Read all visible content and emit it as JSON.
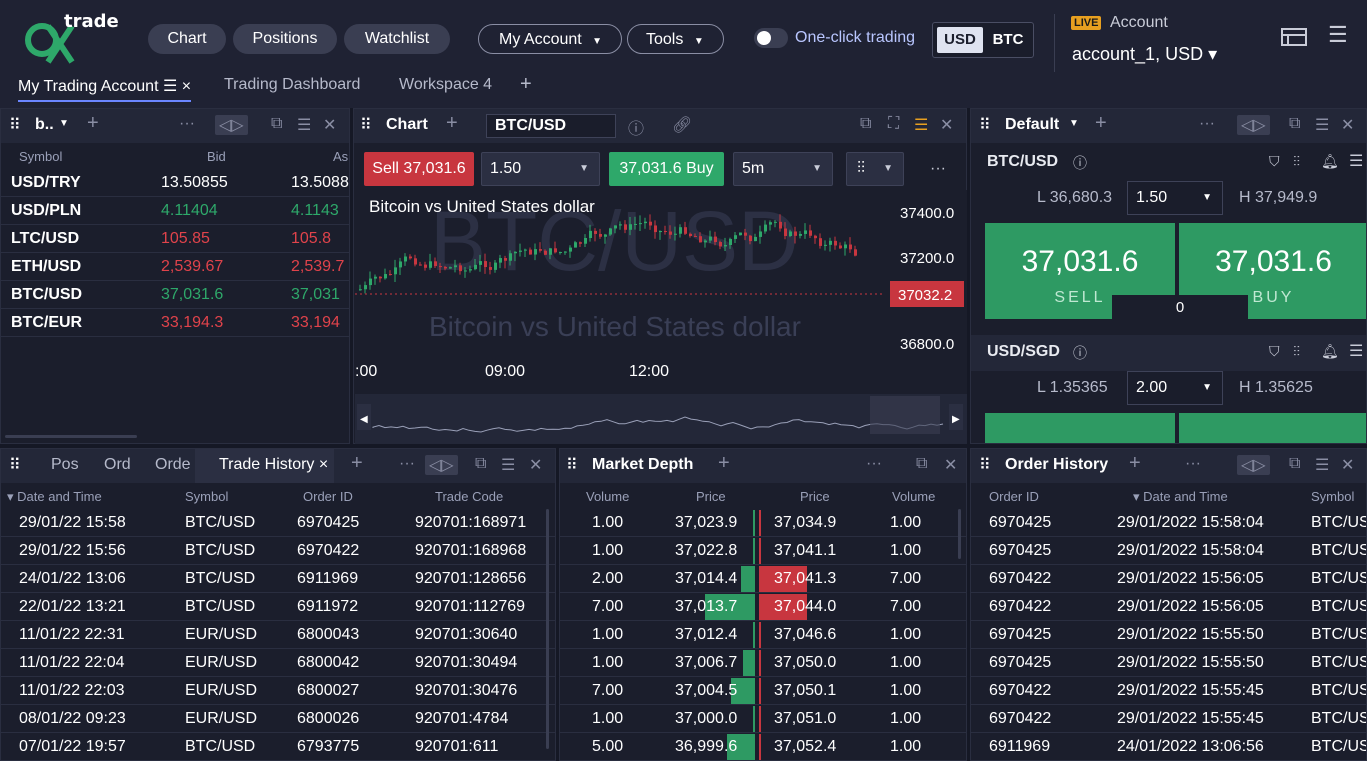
{
  "app": {
    "logo_text": "trade"
  },
  "nav": {
    "chart": "Chart",
    "positions": "Positions",
    "watchlist": "Watchlist",
    "my_account": "My Account",
    "tools": "Tools"
  },
  "one_click": "One-click trading",
  "currency": {
    "usd": "USD",
    "btc": "BTC"
  },
  "account": {
    "live": "LIVE",
    "label": "Account",
    "value": "account_1, USD ▾"
  },
  "workspace_tabs": [
    "My Trading Account ☰ ×",
    "Trading Dashboard",
    "Workspace 4",
    "+"
  ],
  "watchlist": {
    "title": "b..",
    "columns": [
      "Symbol",
      "Bid",
      "As"
    ],
    "rows": [
      {
        "symbol": "USD/TRY",
        "bid": "13.50855",
        "ask": "13.5088",
        "color": "#ffffff"
      },
      {
        "symbol": "USD/PLN",
        "bid": "4.11404",
        "ask": "4.1143",
        "color": "#2ea86a"
      },
      {
        "symbol": "LTC/USD",
        "bid": "105.85",
        "ask": "105.8",
        "color": "#e0434b"
      },
      {
        "symbol": "ETH/USD",
        "bid": "2,539.67",
        "ask": "2,539.7",
        "color": "#e0434b"
      },
      {
        "symbol": "BTC/USD",
        "bid": "37,031.6",
        "ask": "37,031",
        "color": "#2ea86a"
      },
      {
        "symbol": "BTC/EUR",
        "bid": "33,194.3",
        "ask": "33,194",
        "color": "#e0434b"
      }
    ]
  },
  "chart": {
    "title": "Chart",
    "symbol": "BTC/USD",
    "sell": "Sell 37,031.6",
    "qty": "1.50",
    "buy": "37,031.6 Buy",
    "interval": "5m",
    "name": "Bitcoin vs United States dollar",
    "watermark": "BTC/USD",
    "watermark2": "Bitcoin vs United States dollar",
    "price_labels": [
      "37400.0",
      "37200.0",
      "37032.2",
      "36800.0"
    ],
    "time_labels": [
      ":00",
      "09:00",
      "12:00"
    ]
  },
  "default_panel": {
    "title": "Default",
    "pairs": [
      {
        "symbol": "BTC/USD",
        "low": "L 36,680.3",
        "qty": "1.50",
        "high": "H 37,949.9",
        "sell": "37,031.6",
        "buy": "37,031.6",
        "sell_label": "SELL",
        "buy_label": "BUY",
        "spread": "0"
      },
      {
        "symbol": "USD/SGD",
        "low": "L 1.35365",
        "qty": "2.00",
        "high": "H 1.35625"
      }
    ]
  },
  "trade_history": {
    "tabs": [
      "Pos",
      "Ord",
      "Orde",
      "Trade History ×"
    ],
    "columns": [
      "▾ Date and Time",
      "Symbol",
      "Order ID",
      "Trade Code"
    ],
    "rows": [
      [
        "29/01/22 15:58",
        "BTC/USD",
        "6970425",
        "920701:168971"
      ],
      [
        "29/01/22 15:56",
        "BTC/USD",
        "6970422",
        "920701:168968"
      ],
      [
        "24/01/22 13:06",
        "BTC/USD",
        "6911969",
        "920701:128656"
      ],
      [
        "22/01/22 13:21",
        "BTC/USD",
        "6911972",
        "920701:112769"
      ],
      [
        "11/01/22 22:31",
        "EUR/USD",
        "6800043",
        "920701:30640"
      ],
      [
        "11/01/22 22:04",
        "EUR/USD",
        "6800042",
        "920701:30494"
      ],
      [
        "11/01/22 22:03",
        "EUR/USD",
        "6800027",
        "920701:30476"
      ],
      [
        "08/01/22 09:23",
        "EUR/USD",
        "6800026",
        "920701:4784"
      ],
      [
        "07/01/22 19:57",
        "BTC/USD",
        "6793775",
        "920701:611"
      ]
    ]
  },
  "market_depth": {
    "title": "Market Depth",
    "columns": [
      "Volume",
      "Price",
      "Price",
      "Volume"
    ],
    "rows": [
      [
        "1.00",
        "37,023.9",
        "37,034.9",
        "1.00"
      ],
      [
        "1.00",
        "37,022.8",
        "37,041.1",
        "1.00"
      ],
      [
        "2.00",
        "37,014.4",
        "37,041.3",
        "7.00"
      ],
      [
        "7.00",
        "37,013.7",
        "37,044.0",
        "7.00"
      ],
      [
        "1.00",
        "37,012.4",
        "37,046.6",
        "1.00"
      ],
      [
        "1.00",
        "37,006.7",
        "37,050.0",
        "1.00"
      ],
      [
        "7.00",
        "37,004.5",
        "37,050.1",
        "1.00"
      ],
      [
        "1.00",
        "37,000.0",
        "37,051.0",
        "1.00"
      ],
      [
        "5.00",
        "36,999.6",
        "37,052.4",
        "1.00"
      ]
    ]
  },
  "order_history": {
    "title": "Order History",
    "columns": [
      "Order ID",
      "▾ Date and Time",
      "Symbol"
    ],
    "rows": [
      [
        "6970425",
        "29/01/2022 15:58:04",
        "BTC/US"
      ],
      [
        "6970425",
        "29/01/2022 15:58:04",
        "BTC/US"
      ],
      [
        "6970422",
        "29/01/2022 15:56:05",
        "BTC/US"
      ],
      [
        "6970422",
        "29/01/2022 15:56:05",
        "BTC/US"
      ],
      [
        "6970425",
        "29/01/2022 15:55:50",
        "BTC/US"
      ],
      [
        "6970425",
        "29/01/2022 15:55:50",
        "BTC/US"
      ],
      [
        "6970422",
        "29/01/2022 15:55:45",
        "BTC/US"
      ],
      [
        "6970422",
        "29/01/2022 15:55:45",
        "BTC/US"
      ],
      [
        "6911969",
        "24/01/2022 13:06:56",
        "BTC/US"
      ]
    ]
  }
}
